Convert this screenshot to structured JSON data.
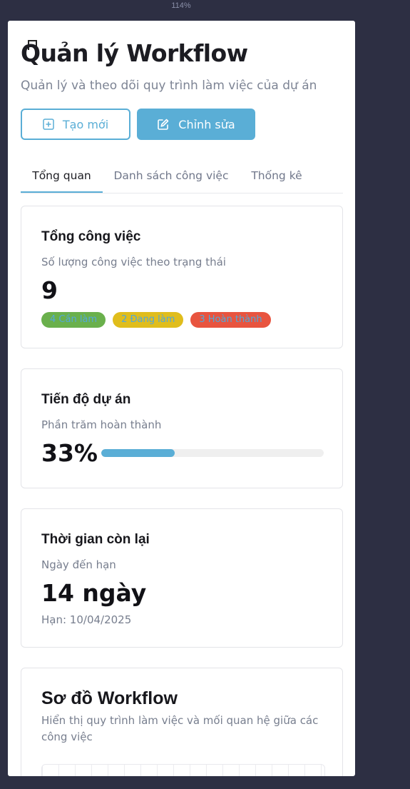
{
  "zoom": "114%",
  "header": {
    "title": "Quản lý Workflow",
    "subtitle": "Quản lý và theo dõi quy trình làm việc của dự án",
    "create_label": "Tạo mới",
    "edit_label": "Chỉnh sửa"
  },
  "tabs": [
    {
      "label": "Tổng quan",
      "active": true
    },
    {
      "label": "Danh sách công việc",
      "active": false
    },
    {
      "label": "Thống kê",
      "active": false
    }
  ],
  "summary": {
    "title": "Tổng công việc",
    "desc": "Số lượng công việc theo trạng thái",
    "total": "9",
    "badges": [
      {
        "label": "4 Cần làm",
        "color": "#6ab04c"
      },
      {
        "label": "2 Đang làm",
        "color": "#e0bd1c"
      },
      {
        "label": "3 Hoàn thành",
        "color": "#e8543f"
      }
    ]
  },
  "progress": {
    "title": "Tiến độ dự án",
    "desc": "Phần trăm hoàn thành",
    "value_label": "33%",
    "fraction": 0.33
  },
  "remaining": {
    "title": "Thời gian còn lại",
    "desc": "Ngày đến hạn",
    "value": "14 ngày",
    "deadline": "Hạn: 10/04/2025"
  },
  "diagram": {
    "title": "Sơ đồ Workflow",
    "desc": "Hiển thị quy trình làm việc và mối quan hệ giữa các công việc"
  },
  "colors": {
    "accent": "#5aaed6",
    "background": "#2d2f43"
  }
}
